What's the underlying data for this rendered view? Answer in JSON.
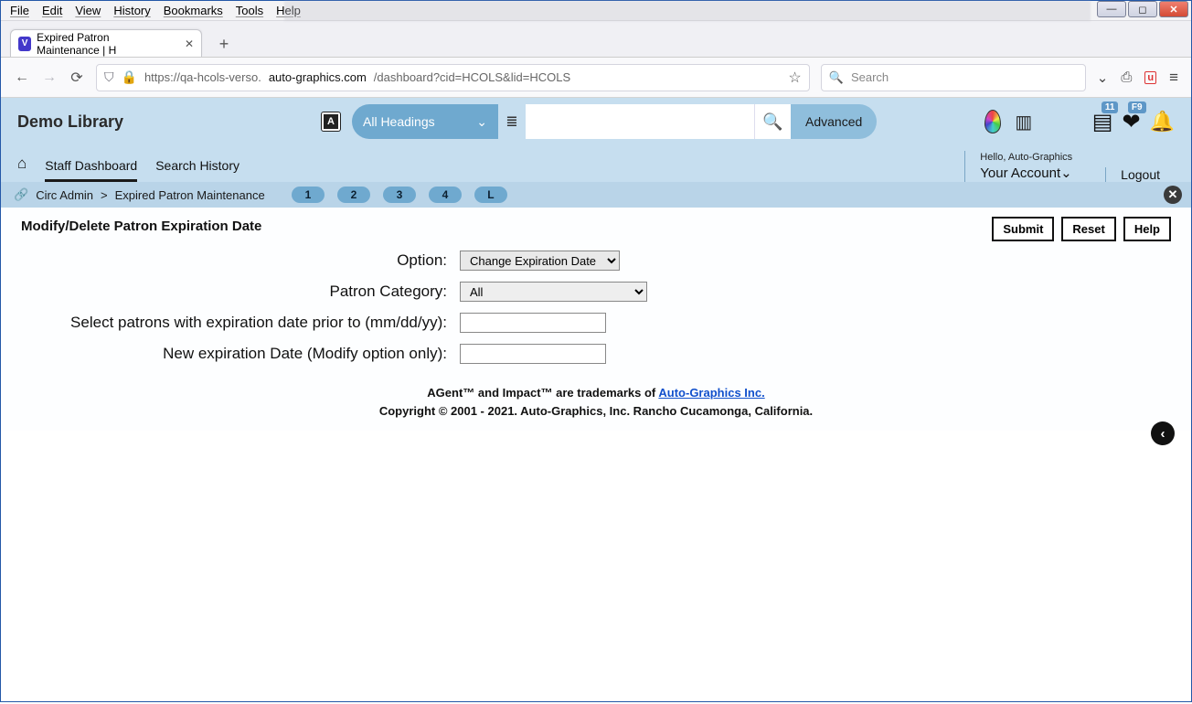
{
  "window": {
    "min": "—",
    "max": "◻",
    "close": "✕"
  },
  "browser_menu": [
    "File",
    "Edit",
    "View",
    "History",
    "Bookmarks",
    "Tools",
    "Help"
  ],
  "tab": {
    "title": "Expired Patron Maintenance | H",
    "close": "✕",
    "fav": "V"
  },
  "newtab_glyph": "+",
  "nav": {
    "url_prefix": "https://qa-hcols-verso.",
    "url_bold": "auto-graphics.com",
    "url_suffix": "/dashboard?cid=HCOLS&lid=HCOLS",
    "search_placeholder": "Search"
  },
  "toolbar_icons": {
    "pocket": "⌄",
    "print": "⎙",
    "block": "u",
    "burger": "≡"
  },
  "app": {
    "library_title": "Demo Library",
    "lang_glyph": "A",
    "all_headings": "All Headings",
    "db_glyph": "≣",
    "advanced": "Advanced",
    "checkouts_badge": "11",
    "fav_badge": "F9"
  },
  "navrow": {
    "staff_dashboard": "Staff Dashboard",
    "search_history": "Search History",
    "hello": "Hello, Auto-Graphics",
    "your_account": "Your Account",
    "logout": "Logout"
  },
  "breadcrumb": {
    "a": "Circ Admin",
    "sep": ">",
    "b": "Expired Patron Maintenance",
    "pills": [
      "1",
      "2",
      "3",
      "4",
      "L"
    ]
  },
  "page": {
    "heading": "Modify/Delete Patron Expiration Date",
    "submit": "Submit",
    "reset": "Reset",
    "help": "Help",
    "label_option": "Option:",
    "option_value": "Change Expiration Date",
    "label_category": "Patron Category:",
    "category_value": "All",
    "label_prior": "Select patrons with expiration date prior to (mm/dd/yy):",
    "label_newdate": "New expiration Date (Modify option only):"
  },
  "footer": {
    "line1a": "AGent™ and Impact™ are trademarks of ",
    "line1b": "Auto-Graphics Inc.",
    "line2": "Copyright © 2001 - 2021. Auto-Graphics, Inc. Rancho Cucamonga, California."
  }
}
